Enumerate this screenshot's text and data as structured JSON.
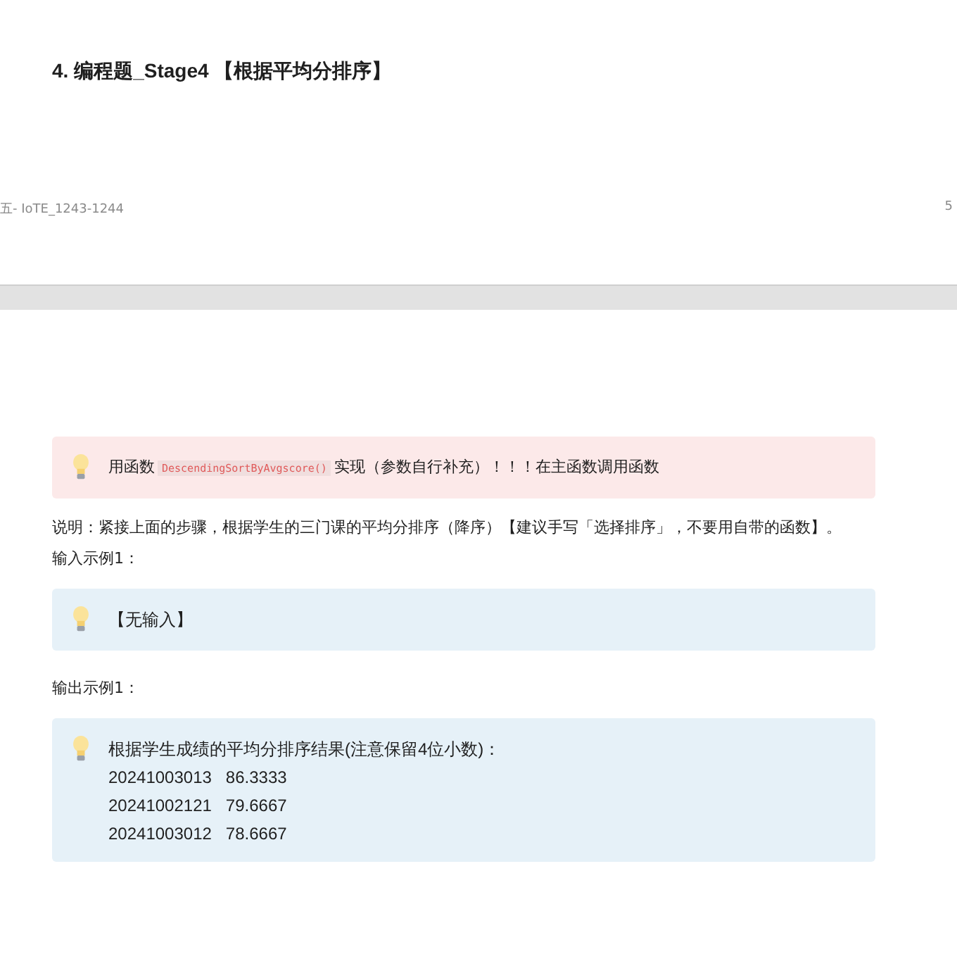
{
  "page_top": {
    "heading": "4. 编程题_Stage4 【根据平均分排序】",
    "footer_left": "五- IoTE_1243-1244",
    "footer_page": "5"
  },
  "blocks": [
    {
      "kind": "callout",
      "color": "#fce9e9",
      "lines": [
        {
          "before": "用函数",
          "code": "DescendingSortByAvgscore()",
          "after": "实现（参数自行补充）！！！在主函数调用函数"
        }
      ]
    },
    {
      "kind": "para",
      "text": "说明：紧接上面的步骤，根据学生的三门课的平均分排序（降序）【建议手写「选择排序」，不要用自带的函数】。"
    },
    {
      "kind": "para",
      "text": "输入示例1："
    },
    {
      "kind": "callout",
      "color": "#e6f1f8",
      "lines": [
        {
          "before": "【无输入】"
        }
      ]
    },
    {
      "kind": "para",
      "text": "输出示例1："
    },
    {
      "kind": "callout",
      "color": "#e6f1f8",
      "lines": [
        {
          "before": "根据学生成绩的平均分排序结果(注意保留4位小数)："
        },
        {
          "before": "20241003013   86.3333"
        },
        {
          "before": "20241002121   79.6667"
        },
        {
          "before": "20241003012   78.6667"
        }
      ]
    }
  ]
}
